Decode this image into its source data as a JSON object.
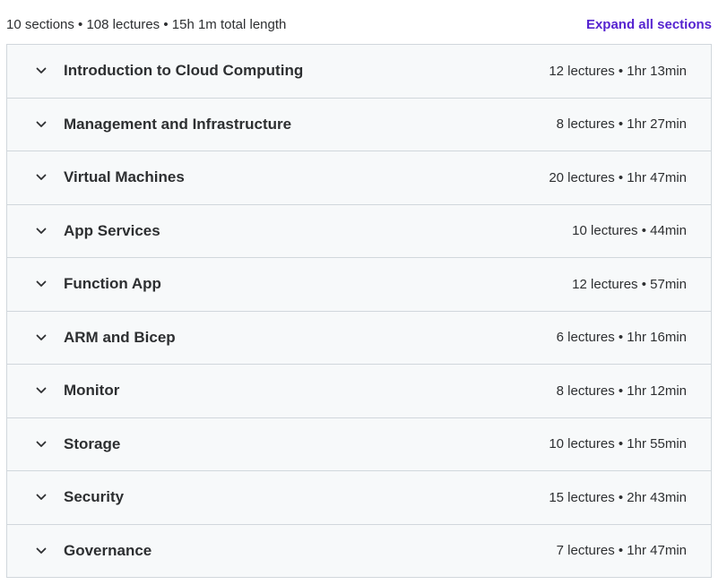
{
  "summary": {
    "text": "10 sections • 108 lectures • 15h 1m total length",
    "expand_label": "Expand all sections"
  },
  "icons": {
    "section_toggle": "chevron-down-icon"
  },
  "colors": {
    "accent": "#5624d0",
    "section_background": "#f7f9fa",
    "border": "#d1d7dc",
    "text": "#2d2f31"
  },
  "sections": [
    {
      "title": "Introduction to Cloud Computing",
      "meta": "12 lectures • 1hr 13min"
    },
    {
      "title": "Management and Infrastructure",
      "meta": "8 lectures • 1hr 27min"
    },
    {
      "title": "Virtual Machines",
      "meta": "20 lectures • 1hr 47min"
    },
    {
      "title": "App Services",
      "meta": "10 lectures • 44min"
    },
    {
      "title": "Function App",
      "meta": "12 lectures • 57min"
    },
    {
      "title": "ARM and Bicep",
      "meta": "6 lectures • 1hr 16min"
    },
    {
      "title": "Monitor",
      "meta": "8 lectures • 1hr 12min"
    },
    {
      "title": "Storage",
      "meta": "10 lectures • 1hr 55min"
    },
    {
      "title": "Security",
      "meta": "15 lectures • 2hr 43min"
    },
    {
      "title": "Governance",
      "meta": "7 lectures • 1hr 47min"
    }
  ]
}
